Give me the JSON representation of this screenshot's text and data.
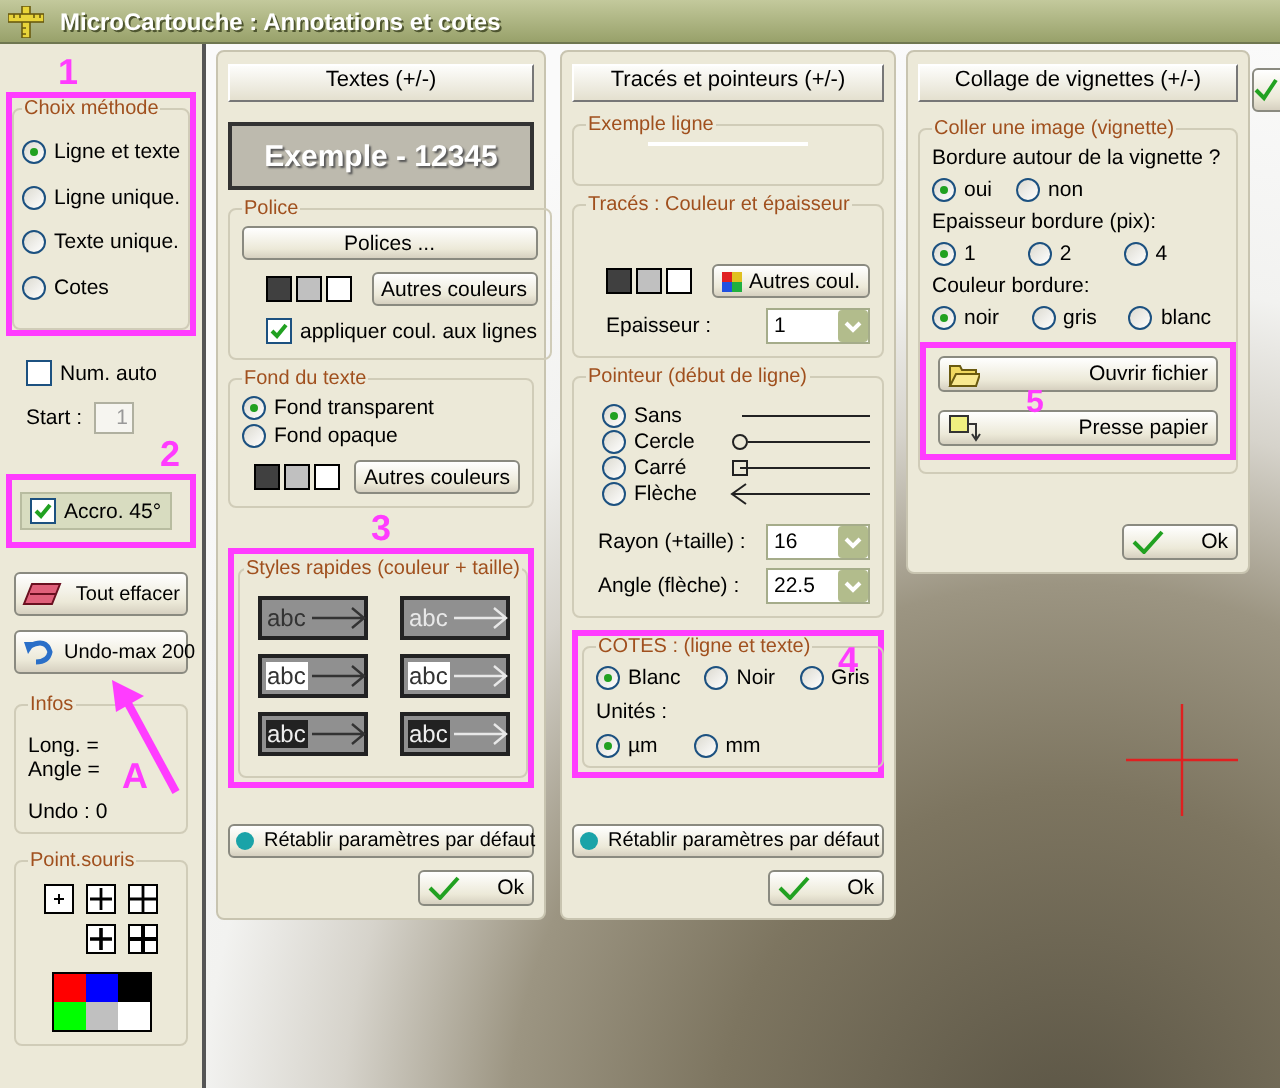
{
  "window": {
    "title": "MicroCartouche : Annotations et cotes"
  },
  "sidebar": {
    "method": {
      "callout": "1",
      "title": "Choix méthode",
      "options": [
        {
          "label": "Ligne et texte",
          "selected": true
        },
        {
          "label": "Ligne unique.",
          "selected": false
        },
        {
          "label": "Texte unique.",
          "selected": false
        },
        {
          "label": "Cotes",
          "selected": false
        }
      ]
    },
    "num_auto": {
      "label": "Num. auto",
      "checked": false
    },
    "start": {
      "label": "Start :",
      "value": "1",
      "disabled": true
    },
    "snap": {
      "callout": "2",
      "label": "Accro. 45°",
      "checked": true
    },
    "clear_button": {
      "label": "Tout effacer"
    },
    "undo_button": {
      "label": "Undo-max 200",
      "callout": "A"
    },
    "infos": {
      "title": "Infos",
      "lines": [
        "Long. =",
        "Angle =",
        "Undo : 0"
      ]
    },
    "mouse_point": {
      "title": "Point.souris",
      "palette": [
        {
          "color": "#ff0000"
        },
        {
          "color": "#0000ff"
        },
        {
          "color": "#000000"
        },
        {
          "color": "#00ff00"
        },
        {
          "color": "#c0c0c0"
        },
        {
          "color": "#ffffff"
        }
      ]
    }
  },
  "texts_panel": {
    "header": "Textes (+/-)",
    "preview": "Exemple - 12345",
    "font_group": {
      "title": "Police",
      "fonts_button": "Polices ...",
      "swatches": [
        {
          "color": "#404040"
        },
        {
          "color": "#c0c0c0"
        },
        {
          "color": "#ffffff"
        }
      ],
      "more_colors": "Autres couleurs",
      "apply_lines": {
        "label": "appliquer coul. aux lignes",
        "checked": true
      }
    },
    "background_group": {
      "title": "Fond du texte",
      "options": [
        {
          "label": "Fond transparent",
          "selected": true
        },
        {
          "label": "Fond opaque",
          "selected": false
        }
      ],
      "swatches": [
        {
          "color": "#404040"
        },
        {
          "color": "#c0c0c0"
        },
        {
          "color": "#ffffff"
        }
      ],
      "more_colors": "Autres couleurs"
    },
    "quick_styles": {
      "callout": "3",
      "title": "Styles rapides (couleur + taille)",
      "tiles": [
        {
          "text": "abc",
          "kind": "plain",
          "color": "#333333"
        },
        {
          "text": "abc",
          "kind": "plain",
          "color": "#e8e8e8"
        },
        {
          "text": "abc",
          "kind": "white",
          "color": "#333333"
        },
        {
          "text": "abc",
          "kind": "white",
          "color": "#e8e8e8"
        },
        {
          "text": "abc",
          "kind": "black",
          "color": "#333333"
        },
        {
          "text": "abc",
          "kind": "black",
          "color": "#e8e8e8"
        }
      ]
    },
    "reset_button": "Rétablir paramètres par défaut",
    "ok_button": "Ok"
  },
  "lines_panel": {
    "header": "Tracés et pointeurs (+/-)",
    "example_group": {
      "title": "Exemple ligne"
    },
    "stroke_group": {
      "title": "Tracés : Couleur et épaisseur",
      "swatches": [
        {
          "color": "#404040"
        },
        {
          "color": "#c0c0c0"
        },
        {
          "color": "#ffffff"
        }
      ],
      "more_colors": "Autres coul.",
      "thickness": {
        "label": "Epaisseur :",
        "value": "1"
      }
    },
    "pointer_group": {
      "title": "Pointeur (début de ligne)",
      "options": [
        {
          "label": "Sans",
          "selected": true,
          "kind": "plain"
        },
        {
          "label": "Cercle",
          "selected": false,
          "kind": "circle"
        },
        {
          "label": "Carré",
          "selected": false,
          "kind": "square"
        },
        {
          "label": "Flèche",
          "selected": false,
          "kind": "arrow"
        }
      ],
      "radius": {
        "label": "Rayon (+taille) :",
        "value": "16"
      },
      "angle": {
        "label": "Angle (flèche) :",
        "value": "22.5"
      }
    },
    "dimensions_group": {
      "callout": "4",
      "title": "COTES : (ligne et texte)",
      "colors": [
        {
          "label": "Blanc",
          "selected": true
        },
        {
          "label": "Noir",
          "selected": false
        },
        {
          "label": "Gris",
          "selected": false
        }
      ],
      "units_label": "Unités :",
      "units": [
        {
          "label": "µm",
          "selected": true
        },
        {
          "label": "mm",
          "selected": false
        }
      ]
    },
    "reset_button": "Rétablir paramètres par défaut",
    "ok_button": "Ok"
  },
  "thumbnail_panel": {
    "header": "Collage de vignettes (+/-)",
    "group": {
      "title": "Coller une image (vignette)",
      "border_question": "Bordure autour de la vignette ?",
      "border": [
        {
          "label": "oui",
          "selected": true
        },
        {
          "label": "non",
          "selected": false
        }
      ],
      "width_label": "Epaisseur bordure (pix):",
      "widths": [
        {
          "label": "1",
          "selected": true
        },
        {
          "label": "2",
          "selected": false
        },
        {
          "label": "4",
          "selected": false
        }
      ],
      "color_label": "Couleur bordure:",
      "colors": [
        {
          "label": "noir",
          "selected": true
        },
        {
          "label": "gris",
          "selected": false
        },
        {
          "label": "blanc",
          "selected": false
        }
      ]
    },
    "callout": "5",
    "open_button": "Ouvrir fichier",
    "clipboard_button": "Presse papier",
    "ok_button": "Ok"
  }
}
